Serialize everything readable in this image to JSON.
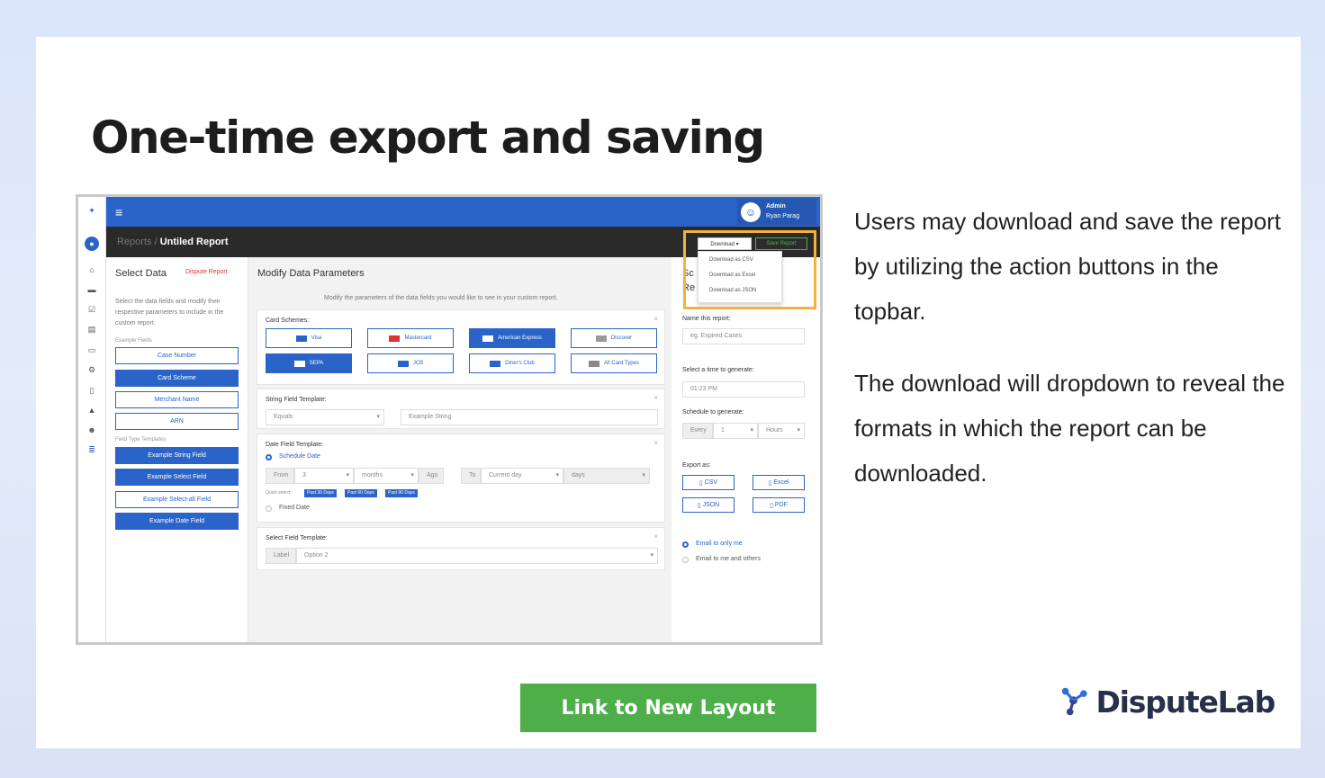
{
  "slide": {
    "title": "One-time export and saving",
    "paragraphs": [
      "Users may download and save the report by utilizing the action buttons in the topbar.",
      "The download will dropdown to reveal the formats in which the report can be downloaded."
    ],
    "link_button": "Link to New Layout",
    "logo_text": "DisputeLab"
  },
  "colors": {
    "accent": "#2b64c8",
    "green": "#4eaf4a",
    "highlight": "#f0b43c"
  },
  "app": {
    "user": {
      "line1": "Admin",
      "line2": "Ryan Parag"
    },
    "breadcrumb": {
      "parent": "Reports",
      "separator": "/",
      "current": "Untiled Report"
    },
    "actions": {
      "download": "Download ▾",
      "save": "Save Report"
    },
    "download_menu": [
      "Download as CSV",
      "Download as Excel",
      "Download as JSON"
    ],
    "left_panel": {
      "title": "Select Data",
      "chip": "Dispute Report",
      "description": "Select the data fields and modify their respective parameters to include in the custom report.",
      "example_fields_label": "Example Fields",
      "fields": [
        "Case Number",
        "Card Scheme",
        "Merchant Name",
        "ARN"
      ],
      "templates_label": "Field Type Templates",
      "templates": [
        "Example String Field",
        "Example Select Field",
        "Example Select-all Field",
        "Example Date Field"
      ]
    },
    "main": {
      "title": "Modify Data Parameters",
      "subtitle": "Modify the parameters of the data fields you would like to see in your custom report.",
      "card_schemes": {
        "label": "Card Schemes:",
        "items": [
          "Visa",
          "Mastercard",
          "American Express",
          "Discover",
          "SEPA",
          "JCB",
          "Diner's Club",
          "All Card Types"
        ]
      },
      "string_template": {
        "label": "String Field Template:",
        "operator": "Equals",
        "placeholder": "Example String"
      },
      "date_template": {
        "label": "Date Field Template:",
        "schedule_option": "Schedule Date",
        "from_label": "From",
        "from_value": "3",
        "unit": "months",
        "ago": "Ago",
        "to_label": "To",
        "to_value": "Current day",
        "to_unit": "days",
        "quick_select": "Quick select:",
        "chips": [
          "Past 30 Days",
          "Past 60 Days",
          "Past 90 Days"
        ],
        "fixed_option": "Fixed Date"
      },
      "select_template": {
        "label": "Select Field Template:",
        "prefix": "Label",
        "value": "Option 2"
      }
    },
    "right_panel": {
      "cut_labels": [
        "Sc",
        "Re"
      ],
      "name_label": "Name this report:",
      "name_placeholder": "eg. Expired Cases",
      "time_label": "Select a time to generate:",
      "time_value": "01:23 PM",
      "schedule_label": "Schedule to generate:",
      "every": "Every",
      "every_value": "1",
      "every_unit": "Hours",
      "export_label": "Export as:",
      "exports": [
        "CSV",
        "Excel",
        "JSON",
        "PDF"
      ],
      "email_options": [
        "Email to only me",
        "Email to me and others"
      ]
    }
  }
}
